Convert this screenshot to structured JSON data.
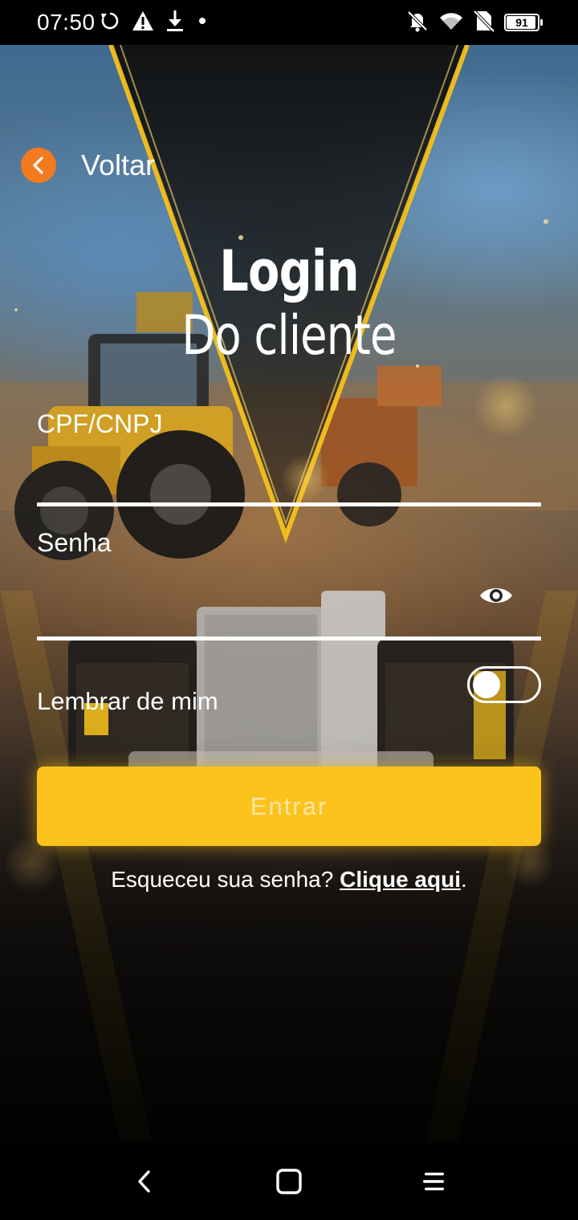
{
  "status_bar": {
    "time": "07:50",
    "left_icons": [
      "sync-icon",
      "warning-icon",
      "download-icon",
      "dot-icon"
    ],
    "right_icons": [
      "notifications-off-icon",
      "wifi-icon",
      "no-sim-icon"
    ],
    "battery_level": "91"
  },
  "back": {
    "label": "Voltar",
    "icon": "chevron-left-icon",
    "color": "#f47a20"
  },
  "title": {
    "main": "Login",
    "sub": "Do cliente"
  },
  "form": {
    "cpf_label": "CPF/CNPJ",
    "cpf_value": "",
    "password_label": "Senha",
    "password_value": "",
    "password_toggle_icon": "eye-icon",
    "remember_label": "Lembrar de mim",
    "remember_enabled": false,
    "submit_label": "Entrar",
    "submit_color": "#fdc31d"
  },
  "forgot": {
    "prefix": "Esqueceu sua senha? ",
    "link": "Clique aqui",
    "suffix": "."
  },
  "nav_bar": {
    "buttons": [
      "back-nav-icon",
      "home-nav-icon",
      "recents-nav-icon"
    ]
  }
}
